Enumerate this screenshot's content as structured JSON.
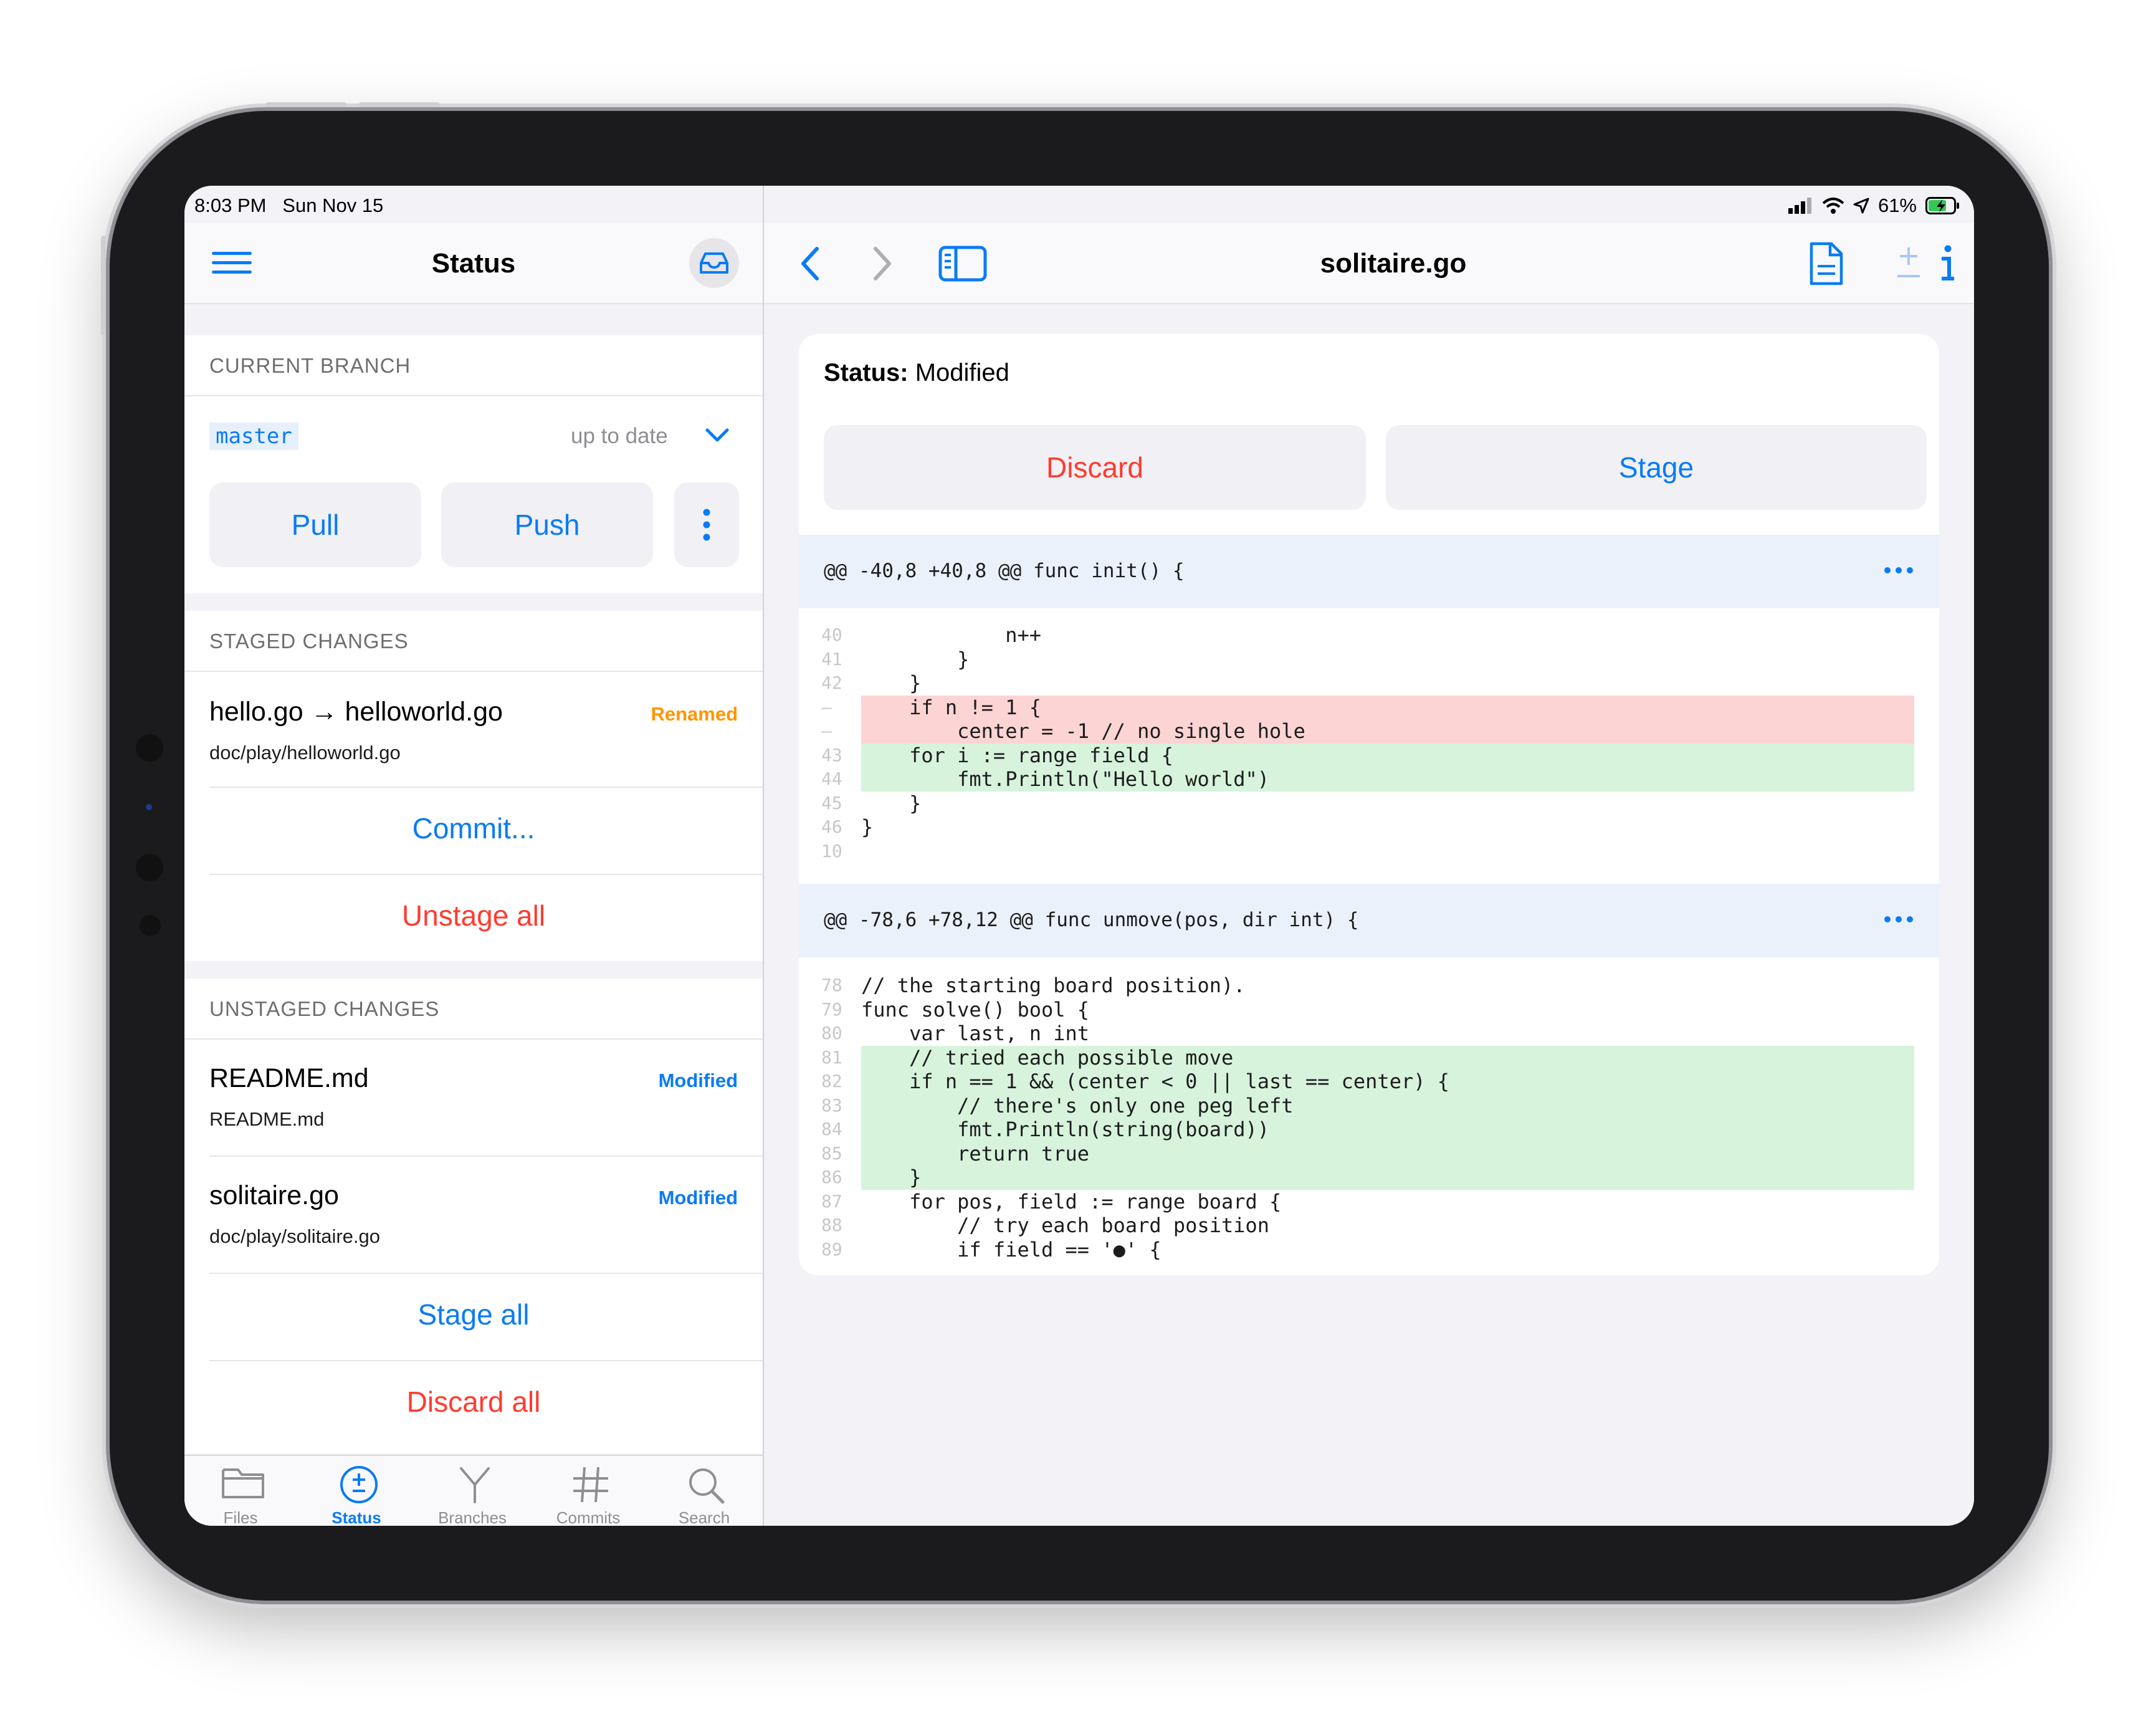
{
  "status_bar": {
    "time": "8:03 PM",
    "date": "Sun Nov 15",
    "battery": "61%"
  },
  "left_panel": {
    "title": "Status",
    "current_branch": {
      "header": "CURRENT BRANCH",
      "branch": "master",
      "sync_status": "up to date",
      "pull_label": "Pull",
      "push_label": "Push"
    },
    "staged": {
      "header": "STAGED CHANGES",
      "files": [
        {
          "title": "hello.go → helloworld.go",
          "path": "doc/play/helloworld.go",
          "status": "Renamed"
        }
      ],
      "commit_label": "Commit...",
      "unstage_all_label": "Unstage all"
    },
    "unstaged": {
      "header": "UNSTAGED CHANGES",
      "files": [
        {
          "title": "README.md",
          "path": "README.md",
          "status": "Modified"
        },
        {
          "title": "solitaire.go",
          "path": "doc/play/solitaire.go",
          "status": "Modified"
        }
      ],
      "stage_all_label": "Stage all",
      "discard_all_label": "Discard all"
    },
    "tabs": [
      {
        "label": "Files",
        "icon": "folder-icon"
      },
      {
        "label": "Status",
        "icon": "plus-minus-circle-icon",
        "active": true
      },
      {
        "label": "Branches",
        "icon": "branch-icon"
      },
      {
        "label": "Commits",
        "icon": "hash-icon"
      },
      {
        "label": "Search",
        "icon": "magnifier-icon"
      }
    ]
  },
  "right_panel": {
    "title": "solitaire.go",
    "status_label": "Status:",
    "status_value": "Modified",
    "discard_label": "Discard",
    "stage_label": "Stage",
    "hunks": [
      {
        "header": "@@ -40,8 +40,8 @@ func init() {",
        "lines": [
          {
            "n": "40",
            "type": "ctx",
            "text": "            n++"
          },
          {
            "n": "41",
            "type": "ctx",
            "text": "        }"
          },
          {
            "n": "42",
            "type": "ctx",
            "text": "    }"
          },
          {
            "n": "–",
            "type": "del",
            "text": "    if n != 1 {"
          },
          {
            "n": "–",
            "type": "del",
            "text": "        center = -1 // no single hole"
          },
          {
            "n": "43",
            "type": "add",
            "text": "    for i := range field {"
          },
          {
            "n": "44",
            "type": "add",
            "text": "        fmt.Println(\"Hello world\")"
          },
          {
            "n": "45",
            "type": "ctx",
            "text": "    }"
          },
          {
            "n": "46",
            "type": "ctx",
            "text": "}"
          },
          {
            "n": "10",
            "type": "ctx",
            "text": ""
          }
        ]
      },
      {
        "header": "@@ -78,6 +78,12 @@ func unmove(pos, dir int) {",
        "lines": [
          {
            "n": "78",
            "type": "ctx",
            "text": "// the starting board position)."
          },
          {
            "n": "79",
            "type": "ctx",
            "text": "func solve() bool {"
          },
          {
            "n": "80",
            "type": "ctx",
            "text": "    var last, n int"
          },
          {
            "n": "81",
            "type": "add",
            "text": "    // tried each possible move"
          },
          {
            "n": "82",
            "type": "add",
            "text": "    if n == 1 && (center < 0 || last == center) {"
          },
          {
            "n": "83",
            "type": "add",
            "text": "        // there's only one peg left"
          },
          {
            "n": "84",
            "type": "add",
            "text": "        fmt.Println(string(board))"
          },
          {
            "n": "85",
            "type": "add",
            "text": "        return true"
          },
          {
            "n": "86",
            "type": "add",
            "text": "    }"
          },
          {
            "n": "87",
            "type": "ctx",
            "text": "    for pos, field := range board {"
          },
          {
            "n": "88",
            "type": "ctx",
            "text": "        // try each board position"
          },
          {
            "n": "89",
            "type": "ctx",
            "text": "        if field == '●' {"
          }
        ]
      }
    ]
  },
  "colors": {
    "accent": "#0a7bf5",
    "destructive": "#ff3b30",
    "renamed": "#ff9500",
    "added_bg": "#d7f3dc",
    "deleted_bg": "#fdd4d4",
    "hunk_bg": "#ebf1fb"
  }
}
